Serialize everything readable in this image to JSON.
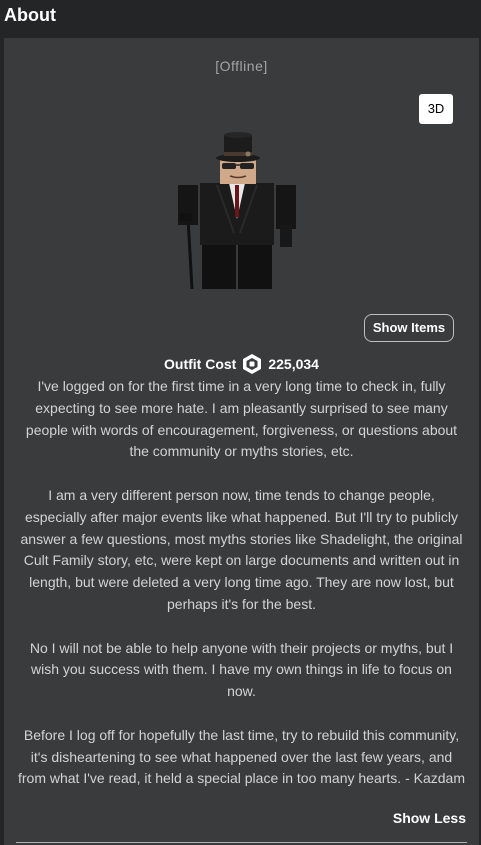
{
  "header": {
    "title": "About"
  },
  "profile": {
    "status": "[Offline]",
    "view_3d_label": "3D",
    "show_items_label": "Show Items",
    "outfit_cost_label": "Outfit Cost",
    "outfit_cost_value": "225,034",
    "about_paragraphs": [
      "I've logged on for the first time in a very long time to check in, fully expecting to see more hate. I am pleasantly surprised to see many people with words of encouragement, forgiveness, or questions about the community or myths stories, etc.",
      "I am a very different person now, time tends to change people, especially after major events like what happened. But I'll try to publicly answer a few questions, most myths stories like Shadelight, the original Cult Family story, etc, were kept on large documents and written out in length, but were deleted a very long time ago. They are now lost, but perhaps it's for the best.",
      "No I will not be able to help anyone with their projects or myths, but I wish you success with them. I have my own things in life to focus on now.",
      "Before I log off for hopefully the last time, try to rebuild this community, it's disheartening to see what happened over the last few years, and from what I've read, it held a special place in too many hearts. - Kazdam"
    ],
    "show_less_label": "Show Less"
  },
  "icons": {
    "robux": "robux-icon",
    "avatar": "avatar-image"
  },
  "colors": {
    "page_background": "#232527",
    "panel_background": "#393b3d",
    "status_text": "#a3a4a5",
    "body_text": "#d2d3d4"
  }
}
